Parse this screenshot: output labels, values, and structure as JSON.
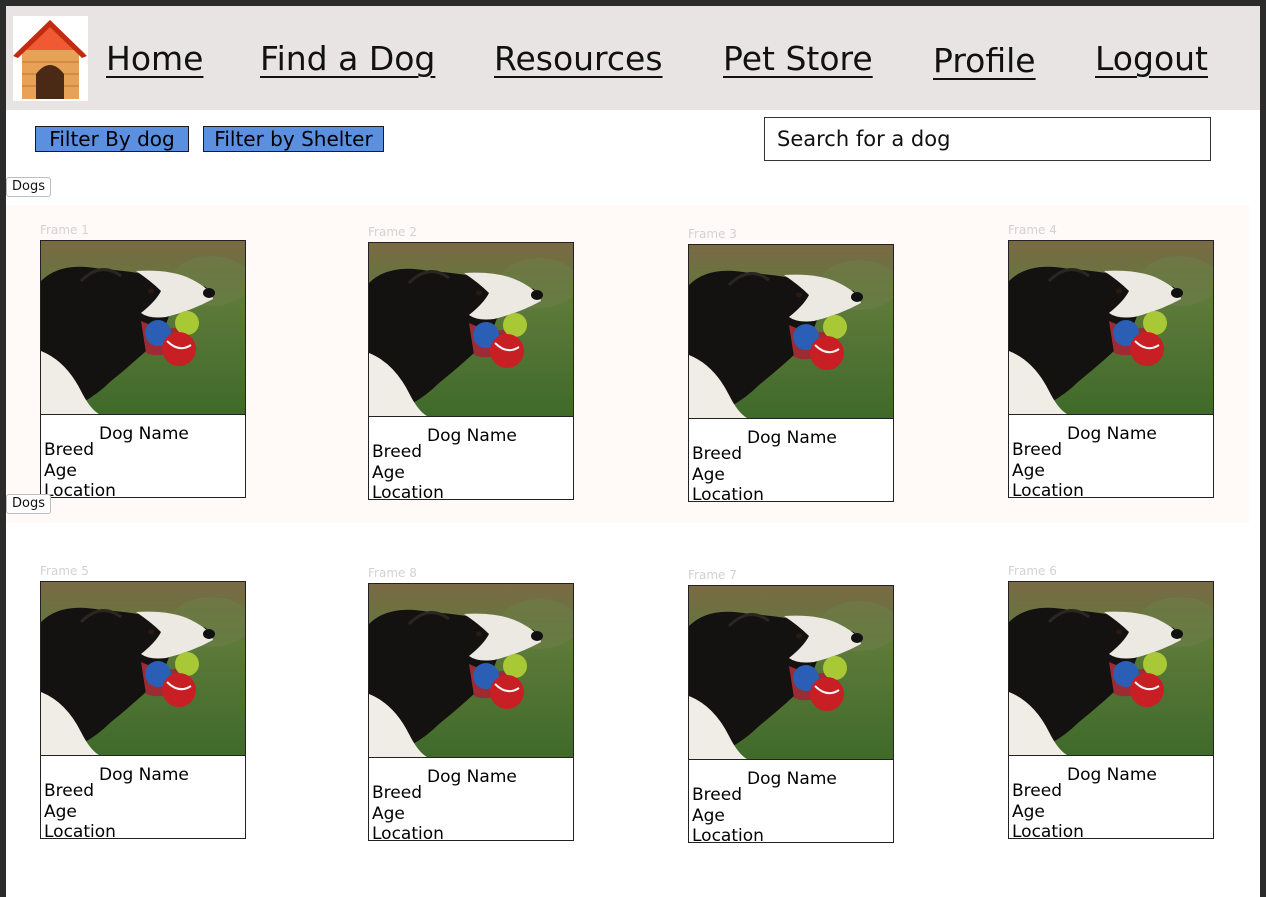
{
  "nav": {
    "logo_icon": "doghouse-icon",
    "links": [
      "Home",
      "Find a Dog",
      "Resources",
      "Pet Store",
      "Profile",
      "Logout"
    ]
  },
  "filters": {
    "by_dog": "Filter By dog",
    "by_shelter": "Filter by Shelter"
  },
  "search": {
    "placeholder": "Search for a dog"
  },
  "section_tags": [
    "Dogs",
    "Dogs"
  ],
  "cards": [
    {
      "frame": "Frame 1",
      "name": "Dog Name",
      "breed": "Breed",
      "age": "Age",
      "location": "Location"
    },
    {
      "frame": "Frame 2",
      "name": "Dog Name",
      "breed": "Breed",
      "age": "Age",
      "location": "Location"
    },
    {
      "frame": "Frame 3",
      "name": "Dog Name",
      "breed": "Breed",
      "age": "Age",
      "location": "Location"
    },
    {
      "frame": "Frame 4",
      "name": "Dog Name",
      "breed": "Breed",
      "age": "Age",
      "location": "Location"
    },
    {
      "frame": "Frame 5",
      "name": "Dog Name",
      "breed": "Breed",
      "age": "Age",
      "location": "Location"
    },
    {
      "frame": "Frame 8",
      "name": "Dog Name",
      "breed": "Breed",
      "age": "Age",
      "location": "Location"
    },
    {
      "frame": "Frame 7",
      "name": "Dog Name",
      "breed": "Breed",
      "age": "Age",
      "location": "Location"
    },
    {
      "frame": "Frame 6",
      "name": "Dog Name",
      "breed": "Breed",
      "age": "Age",
      "location": "Location"
    }
  ],
  "colors": {
    "nav_bg": "#e8e4e4",
    "filter_button": "#5b8fe0",
    "row_highlight": "#fff9f8"
  }
}
